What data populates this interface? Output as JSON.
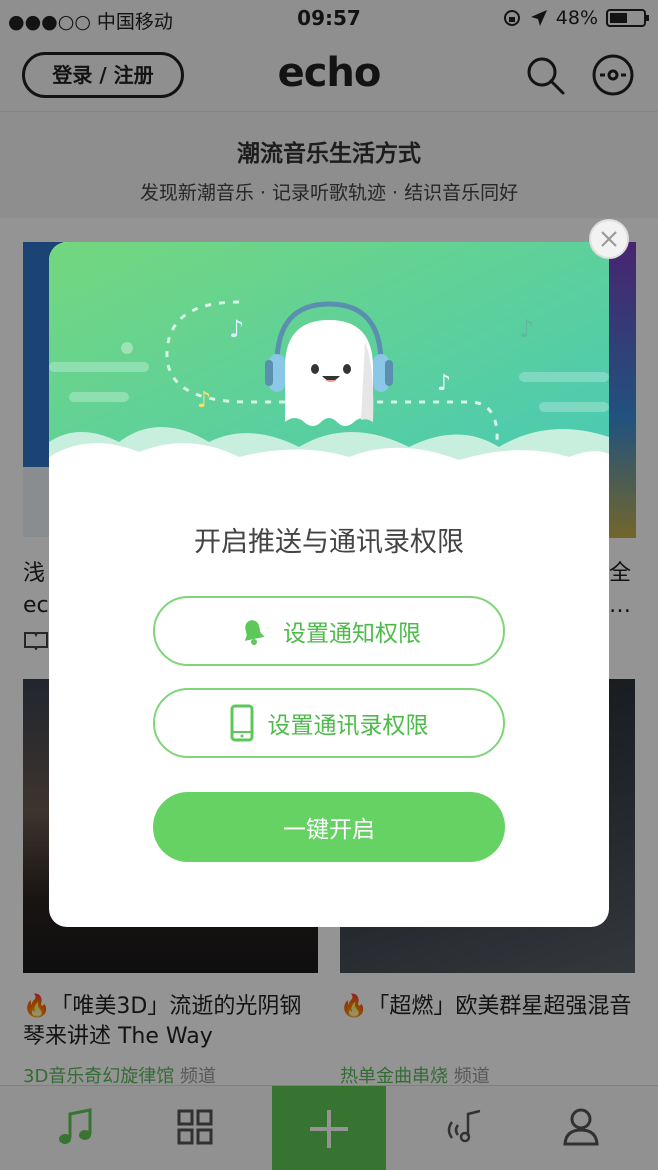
{
  "status_bar": {
    "carrier": "●●●○○ 中国移动",
    "time": "09:57",
    "battery": "48%",
    "battery_level": 0.48
  },
  "header": {
    "login_label": "登录 / 注册",
    "logo": "echo",
    "search_icon": "search-icon",
    "profile_icon": "disc-icon"
  },
  "slogan": {
    "title": "潮流音乐生活方式",
    "subtitle": "发现新潮音乐 · 记录听歌轨迹 · 结识音乐同好"
  },
  "background": {
    "row1_left_text": "浅\nec",
    "row1_right_text": "全\n…",
    "cards": [
      {
        "title": "「唯美3D」流逝的光阴钢琴来讲述 The Way",
        "channel": "3D音乐奇幻旋律馆",
        "channel_suffix": "频道"
      },
      {
        "title": "「超燃」欧美群星超强混音",
        "channel": "热单金曲串烧",
        "channel_suffix": "频道"
      }
    ]
  },
  "tabbar": {
    "items": [
      "music-note-icon",
      "grid-icon",
      "plus-icon",
      "radio-wave-icon",
      "user-icon"
    ]
  },
  "modal": {
    "title": "开启推送与通讯录权限",
    "notify_button": "设置通知权限",
    "contacts_button": "设置通讯录权限",
    "primary_button": "一键开启",
    "colors": {
      "accent": "#66d264",
      "hero_top": "#6bd48a",
      "hero_bottom": "#4ecbb4"
    }
  }
}
